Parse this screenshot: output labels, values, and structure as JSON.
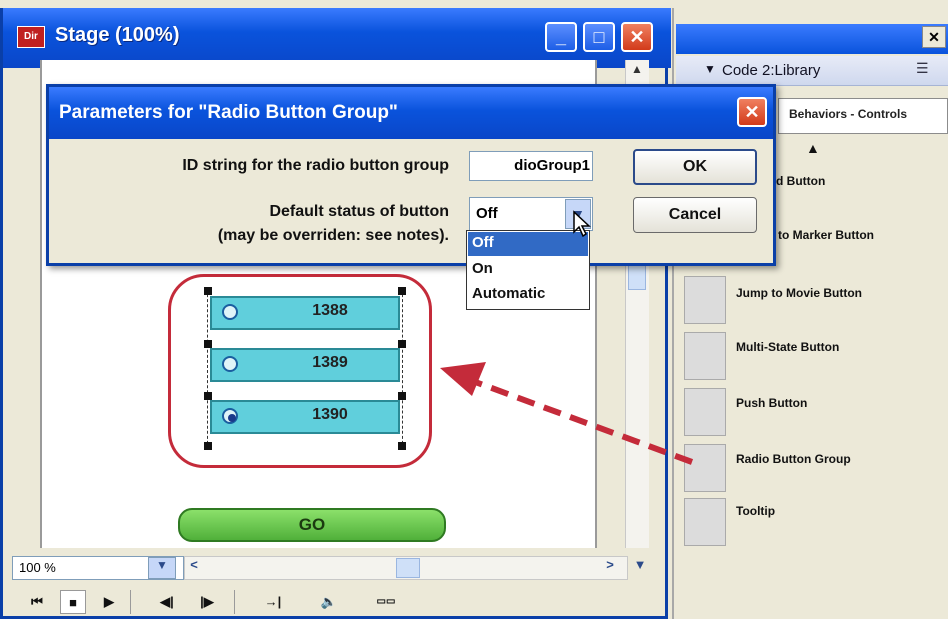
{
  "stage": {
    "title": "Stage (100%)",
    "app_badge": "Dir",
    "zoom": "100 %",
    "radio_buttons": [
      "1388",
      "1389",
      "1390"
    ],
    "go_label": "GO"
  },
  "library": {
    "header": "Code 2:Library",
    "category": "Behaviors - Controls",
    "items": [
      {
        "label": "Forward Button",
        "icon": "forward-button-icon"
      },
      {
        "label": "to Marker Button",
        "icon": "marker-button-icon"
      },
      {
        "label": "Jump to Movie Button",
        "icon": "movie-button-icon"
      },
      {
        "label": "Multi-State Button",
        "icon": "multistate-button-icon"
      },
      {
        "label": "Push Button",
        "icon": "push-button-icon"
      },
      {
        "label": "Radio Button Group",
        "icon": "radio-group-icon"
      },
      {
        "label": "Tooltip",
        "icon": "tooltip-icon"
      }
    ]
  },
  "dialog": {
    "title": "Parameters for \"Radio Button Group\"",
    "id_label": "ID string for the radio button group",
    "id_value": "dioGroup1",
    "default_label": "Default status of button",
    "default_note": "(may be overriden: see notes).",
    "default_value": "Off",
    "options": [
      "Off",
      "On",
      "Automatic"
    ],
    "ok_label": "OK",
    "cancel_label": "Cancel"
  },
  "colors": {
    "titlebar": "#0a53dc",
    "highlight": "#c42b3a",
    "radio_fill": "#60cfdc",
    "go_fill": "#50b03a"
  }
}
